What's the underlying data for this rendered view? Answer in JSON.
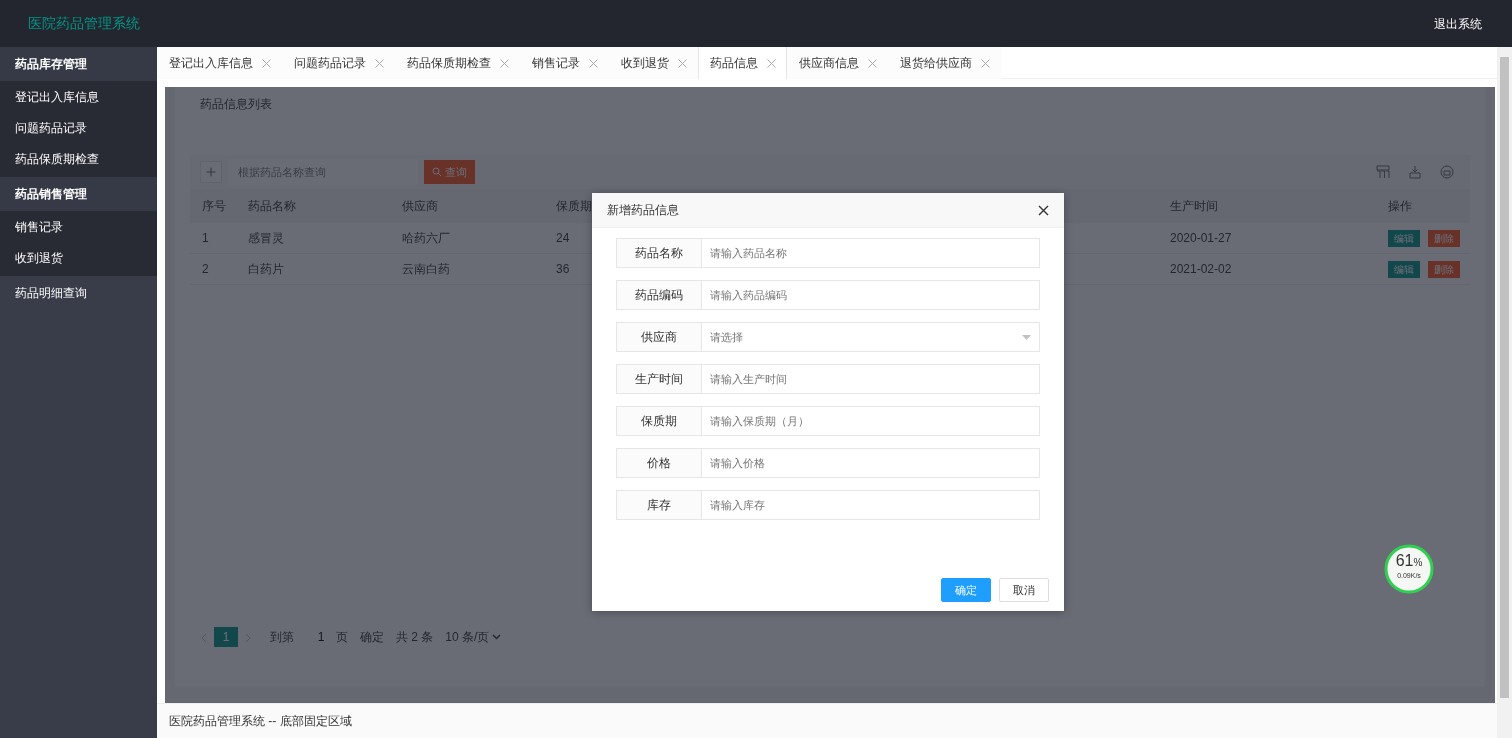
{
  "app": {
    "title": "医院药品管理系统",
    "logout": "退出系统"
  },
  "sidebar": [
    {
      "label": "药品库存管理",
      "kind": "group",
      "children": [
        {
          "label": "登记出入库信息"
        },
        {
          "label": "问题药品记录"
        },
        {
          "label": "药品保质期检查"
        }
      ]
    },
    {
      "label": "药品销售管理",
      "kind": "group",
      "children": [
        {
          "label": "销售记录"
        },
        {
          "label": "收到退货"
        }
      ]
    },
    {
      "label": "药品明细查询",
      "kind": "link"
    }
  ],
  "tabs": [
    {
      "label": "登记出入库信息",
      "selected": false
    },
    {
      "label": "问题药品记录",
      "selected": false
    },
    {
      "label": "药品保质期检查",
      "selected": false
    },
    {
      "label": "销售记录",
      "selected": false
    },
    {
      "label": "收到退货",
      "selected": false
    },
    {
      "label": "药品信息",
      "selected": true
    },
    {
      "label": "供应商信息",
      "selected": false
    },
    {
      "label": "退货给供应商",
      "selected": false
    }
  ],
  "panel": {
    "title": "药品信息列表",
    "search_placeholder": "根据药品名称查询",
    "search_button": "查询",
    "columns": [
      "序号",
      "药品名称",
      "供应商",
      "保质期",
      "生产时间",
      "操作"
    ],
    "rows": [
      {
        "cells": [
          "1",
          "感冒灵",
          "哈药六厂",
          "24",
          "2020-01-27"
        ],
        "actions": [
          "编辑",
          "删除"
        ]
      },
      {
        "cells": [
          "2",
          "白药片",
          "云南白药",
          "36",
          "2021-02-02"
        ],
        "actions": [
          "编辑",
          "删除"
        ]
      }
    ],
    "pagination": {
      "pages": [
        {
          "label": "1",
          "selected": true
        }
      ],
      "goto_label": "到第",
      "goto_value": "1",
      "page_unit": "页",
      "confirm": "确定",
      "total": "共 2 条",
      "page_size": "10 条/页"
    }
  },
  "modal": {
    "title": "新增药品信息",
    "fields": [
      {
        "label": "药品名称",
        "placeholder": "请输入药品名称",
        "kind": "text"
      },
      {
        "label": "药品编码",
        "placeholder": "请输入药品编码",
        "kind": "text"
      },
      {
        "label": "供应商",
        "placeholder": "请选择",
        "kind": "select"
      },
      {
        "label": "生产时间",
        "placeholder": "请输入生产时间",
        "kind": "text"
      },
      {
        "label": "保质期",
        "placeholder": "请输入保质期（月）",
        "kind": "text"
      },
      {
        "label": "价格",
        "placeholder": "请输入价格",
        "kind": "text"
      },
      {
        "label": "库存",
        "placeholder": "请输入库存",
        "kind": "text"
      }
    ],
    "buttons": [
      {
        "label": "确定",
        "kind": "primary"
      },
      {
        "label": "取消",
        "kind": "default"
      }
    ]
  },
  "footer": "医院药品管理系统 -- 底部固定区域",
  "widget": {
    "percent": "61",
    "unit": "%",
    "speed": "0.09K/s"
  }
}
